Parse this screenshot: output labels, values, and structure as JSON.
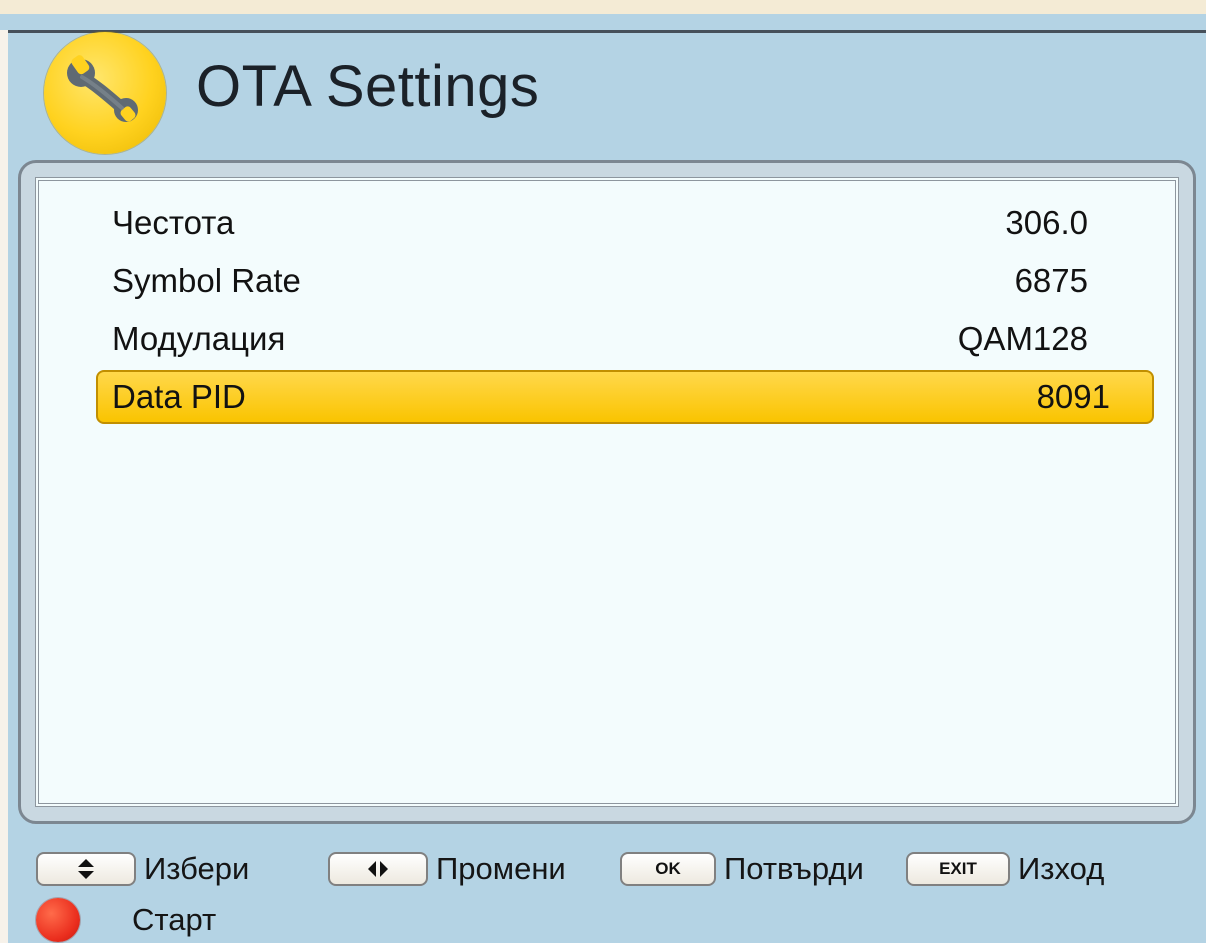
{
  "header": {
    "title": "OTA Settings",
    "icon": "wrench-icon"
  },
  "settings": [
    {
      "label": "Честота",
      "value": "306.0"
    },
    {
      "label": "Symbol Rate",
      "value": "6875"
    },
    {
      "label": "Модулация",
      "value": "QAM128"
    },
    {
      "label": "Data PID",
      "value": "8091",
      "selected": true
    }
  ],
  "footer": {
    "select_hint": "Избери",
    "change_hint": "Промени",
    "ok_key": "OK",
    "confirm_hint": "Потвърди",
    "exit_key": "EXIT",
    "exit_hint": "Изход",
    "start_hint": "Старт"
  },
  "colors": {
    "background": "#b4d3e4",
    "panel": "#f3fcfd",
    "selected_row": "#fac400",
    "header_icon": "#ffd21f",
    "record_button": "#ea2d1d"
  }
}
